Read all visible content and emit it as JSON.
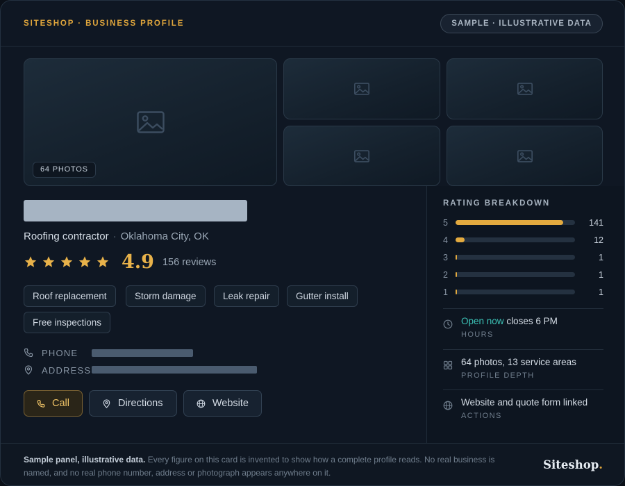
{
  "header": {
    "kicker": "SITESHOP · BUSINESS PROFILE",
    "sample_badge": "SAMPLE · ILLUSTRATIVE DATA"
  },
  "gallery": {
    "photo_count_label": "64 PHOTOS"
  },
  "profile": {
    "category": "Roofing contractor",
    "separator": "·",
    "location": "Oklahoma City, OK",
    "rating": "4.9",
    "stars_filled": 5,
    "reviews_label": "156 reviews",
    "services": [
      "Roof replacement",
      "Storm damage",
      "Leak repair",
      "Gutter install",
      "Free inspections"
    ]
  },
  "contact": {
    "phone_label": "PHONE",
    "address_label": "ADDRESS"
  },
  "actions": {
    "call": "Call",
    "directions": "Directions",
    "website": "Website"
  },
  "rating_breakdown": {
    "title": "RATING BREAKDOWN",
    "rows": [
      {
        "stars": "5",
        "count": "141",
        "share": 0.904
      },
      {
        "stars": "4",
        "count": "12",
        "share": 0.077
      },
      {
        "stars": "3",
        "count": "1",
        "share": 0.006
      },
      {
        "stars": "2",
        "count": "1",
        "share": 0.006
      },
      {
        "stars": "1",
        "count": "1",
        "share": 0.006
      }
    ]
  },
  "info": {
    "hours": {
      "status": "Open now",
      "detail": "closes 6 PM",
      "label": "HOURS"
    },
    "depth": {
      "text": "64 photos, 13 service areas",
      "label": "PROFILE DEPTH"
    },
    "actions": {
      "text": "Website and quote form linked",
      "label": "ACTIONS"
    }
  },
  "footer": {
    "lead": "Sample panel, illustrative data.",
    "body": "Every figure on this card is invented to show how a complete profile reads. No real business is named, and no real phone number, address or photograph appears anywhere on it.",
    "brand": "Siteshop",
    "brand_dot": "."
  },
  "colors": {
    "accent": "#e0a63c",
    "open_status": "#3cc2b6",
    "background": "#0f1723"
  }
}
